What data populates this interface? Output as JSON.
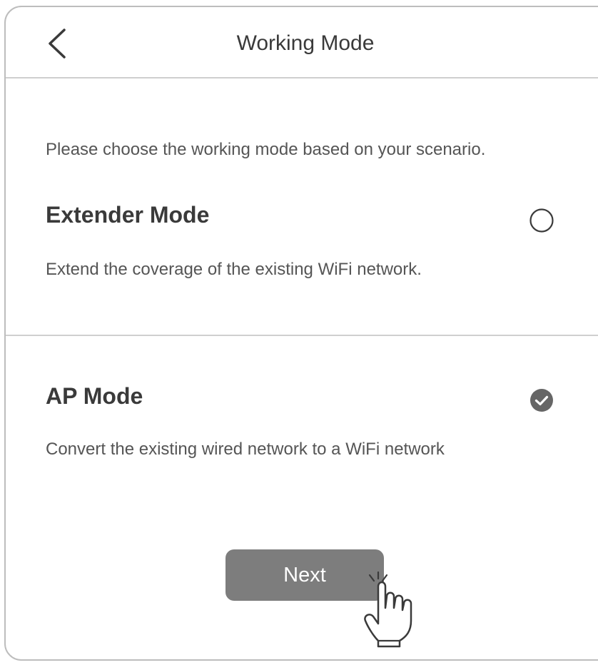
{
  "header": {
    "back_icon": "chevron-left-icon",
    "title": "Working Mode"
  },
  "main": {
    "instruction": "Please choose the working mode based on your scenario.",
    "modes": [
      {
        "title": "Extender Mode",
        "description": "Extend the coverage of the existing WiFi network.",
        "selected": false,
        "icon": "radio-unchecked-icon"
      },
      {
        "title": "AP Mode",
        "description": "Convert the existing wired network to a WiFi network",
        "selected": true,
        "icon": "radio-checked-icon"
      }
    ],
    "next_label": "Next"
  },
  "overlay": {
    "pointer_icon": "hand-pointer-icon"
  },
  "colors": {
    "text": "#3a3a3a",
    "secondary_text": "#555555",
    "button": "#7d7d7d",
    "divider": "#cfcfcf",
    "radio_checked": "#666666"
  }
}
